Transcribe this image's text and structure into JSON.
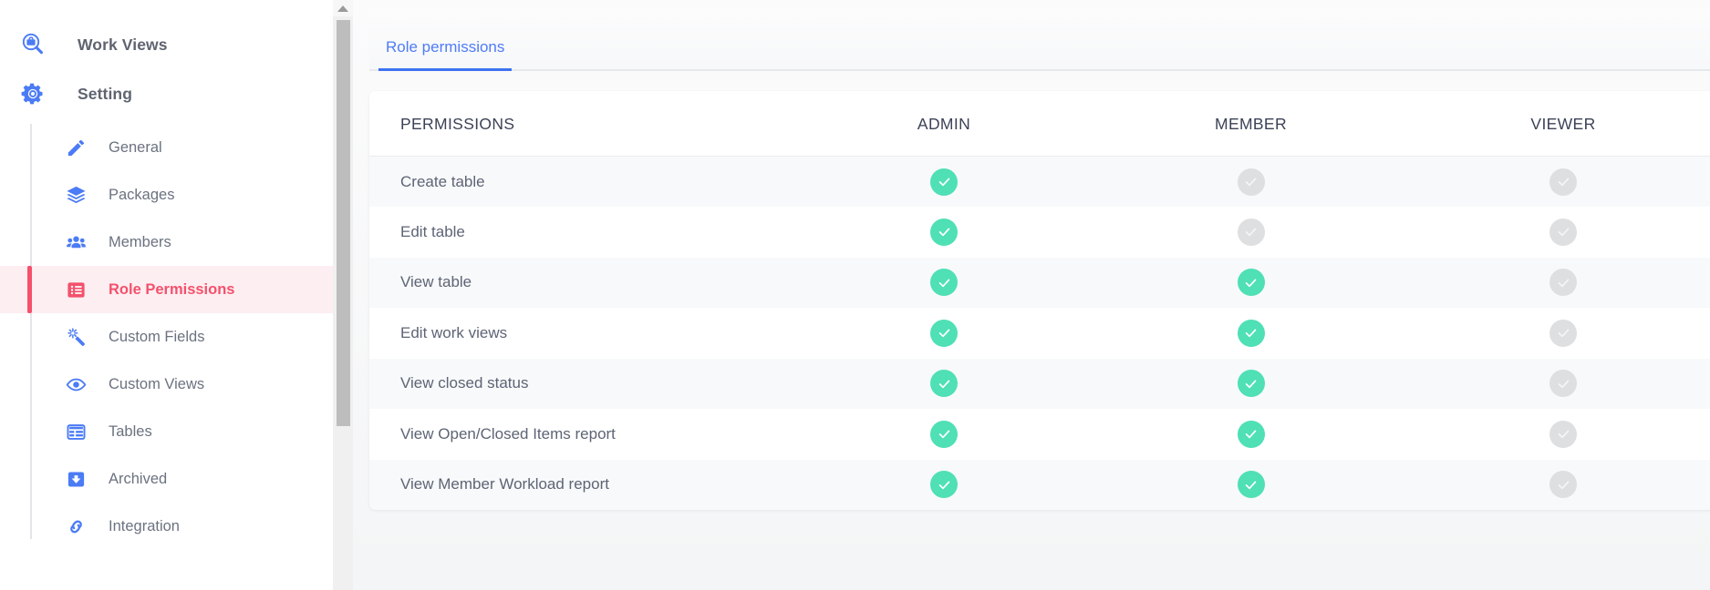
{
  "sidebar": {
    "sections": [
      {
        "label": "Work Views",
        "icon": "briefcase-search-icon"
      },
      {
        "label": "Setting",
        "icon": "gear-icon"
      }
    ],
    "items": [
      {
        "label": "General",
        "icon": "pencil-icon",
        "active": false
      },
      {
        "label": "Packages",
        "icon": "layers-icon",
        "active": false
      },
      {
        "label": "Members",
        "icon": "people-icon",
        "active": false
      },
      {
        "label": "Role Permissions",
        "icon": "list-icon",
        "active": true
      },
      {
        "label": "Custom Fields",
        "icon": "magic-wand-icon",
        "active": false
      },
      {
        "label": "Custom Views",
        "icon": "eye-icon",
        "active": false
      },
      {
        "label": "Tables",
        "icon": "table-icon",
        "active": false
      },
      {
        "label": "Archived",
        "icon": "archive-box-icon",
        "active": false
      },
      {
        "label": "Integration",
        "icon": "link-icon",
        "active": false
      }
    ]
  },
  "scrollbar": {
    "up_arrow_icon": "chevron-up-icon"
  },
  "main": {
    "tabs": [
      {
        "label": "Role permissions",
        "active": true
      }
    ]
  },
  "table": {
    "columns": [
      "PERMISSIONS",
      "ADMIN",
      "MEMBER",
      "VIEWER"
    ],
    "rows": [
      {
        "permission": "Create table",
        "admin": true,
        "member": false,
        "viewer": false
      },
      {
        "permission": "Edit table",
        "admin": true,
        "member": false,
        "viewer": false
      },
      {
        "permission": "View table",
        "admin": true,
        "member": true,
        "viewer": false
      },
      {
        "permission": "Edit work views",
        "admin": true,
        "member": true,
        "viewer": false
      },
      {
        "permission": "View closed status",
        "admin": true,
        "member": true,
        "viewer": false
      },
      {
        "permission": "View Open/Closed Items report",
        "admin": true,
        "member": true,
        "viewer": false
      },
      {
        "permission": "View Member Workload report",
        "admin": true,
        "member": true,
        "viewer": false
      }
    ]
  },
  "colors": {
    "accent_blue": "#3f72f0",
    "active_pink": "#f4516c",
    "active_pink_bg": "#fdeef1",
    "check_on": "#4fe0b5",
    "check_off": "#dddfe0",
    "icon_blue": "#4b7bf5",
    "page_bg": "#f4f5f6"
  }
}
